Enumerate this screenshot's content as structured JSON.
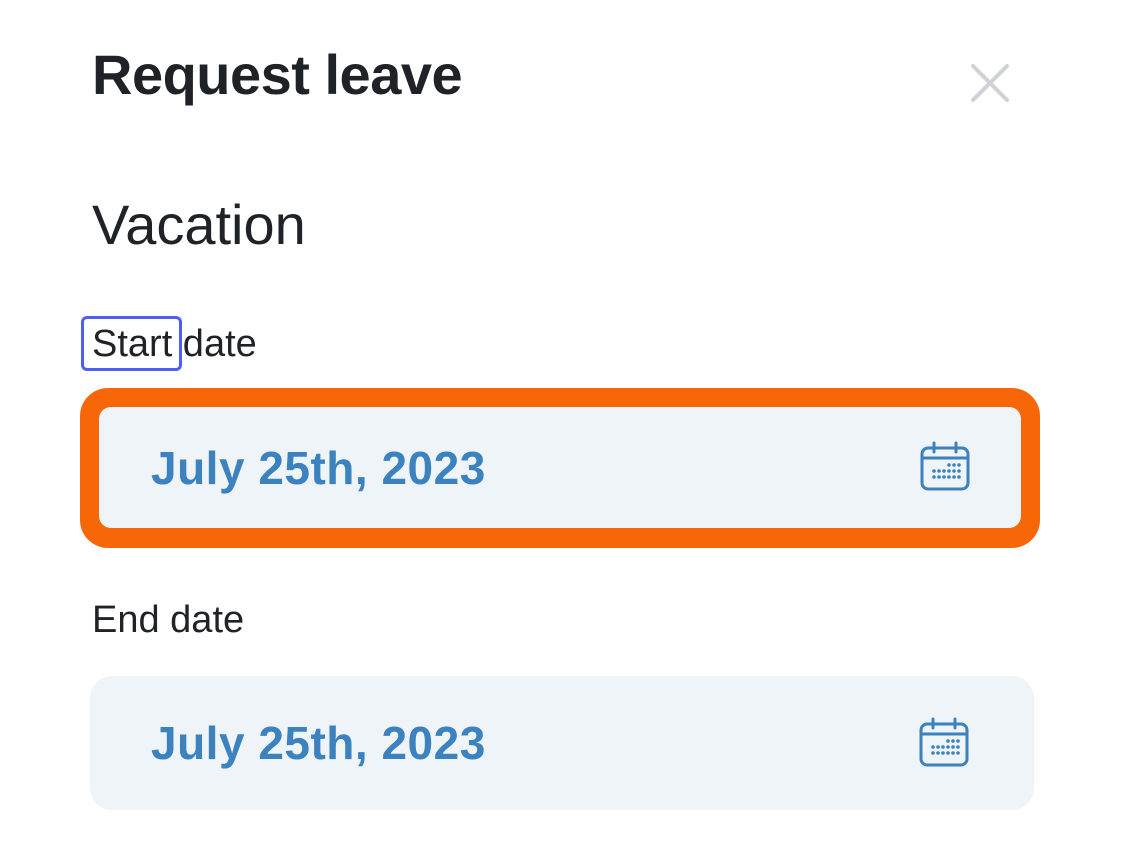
{
  "header": {
    "title": "Request leave",
    "close_icon": "close-icon"
  },
  "leave_type": "Vacation",
  "start_date": {
    "label_highlighted": "Start",
    "label_rest": " date",
    "value": "July 25th, 2023",
    "icon": "calendar-icon"
  },
  "end_date": {
    "label": "End date",
    "value": "July 25th, 2023",
    "icon": "calendar-icon"
  },
  "colors": {
    "date_text": "#3b82bf",
    "field_bg": "#eff4f9",
    "focus_ring": "#f76707",
    "word_highlight": "#4f5ff0",
    "close_icon": "#cfd2d6"
  }
}
